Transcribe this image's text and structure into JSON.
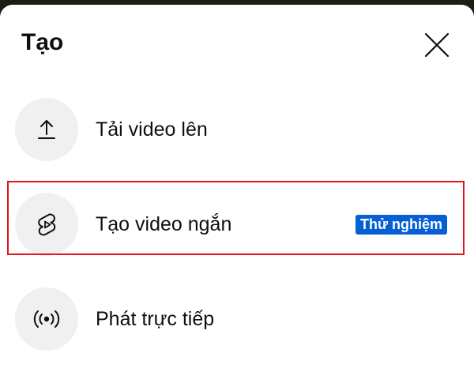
{
  "sheet": {
    "title": "Tạo",
    "close_icon": "close-icon"
  },
  "items": [
    {
      "label": "Tải video lên",
      "icon": "upload-icon"
    },
    {
      "label": "Tạo video ngắn",
      "icon": "shorts-icon",
      "badge": "Thử nghiệm"
    },
    {
      "label": "Phát trực tiếp",
      "icon": "live-broadcast-icon"
    }
  ],
  "colors": {
    "badge": "#065fd4",
    "highlight_border": "#e0161c",
    "icon_circle": "#f0f0f0"
  }
}
